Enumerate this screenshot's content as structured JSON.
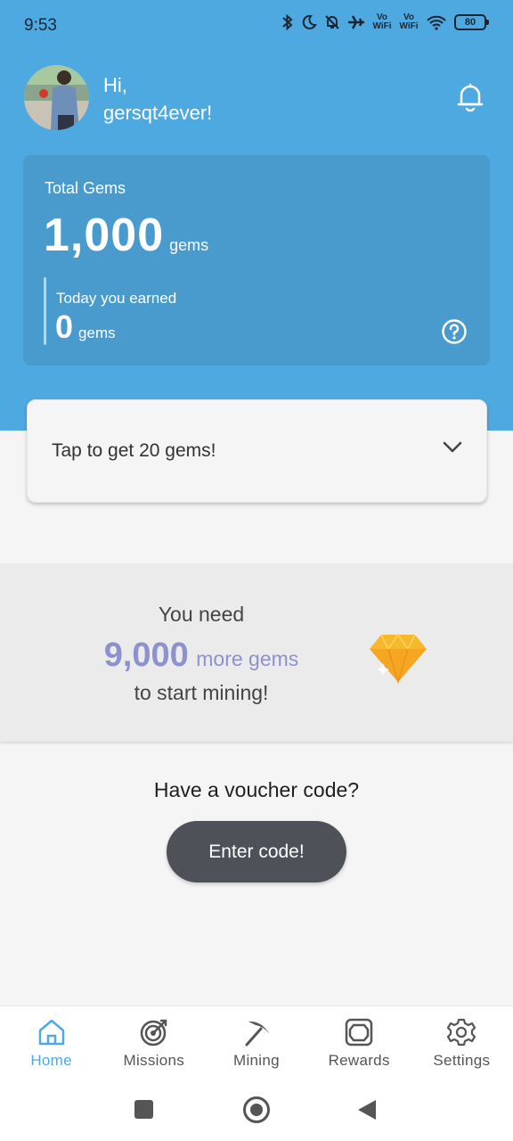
{
  "status_bar": {
    "time": "9:53",
    "vowifi_1": "Vo WiFi",
    "vowifi_2": "Vo WiFi",
    "battery": "80",
    "icons": [
      "bluetooth-icon",
      "moon-icon",
      "bell-muted-icon",
      "airplane-icon",
      "wifi-icon"
    ]
  },
  "header": {
    "greeting_line1": "Hi,",
    "greeting_line2": "gersqt4ever!"
  },
  "gems": {
    "label": "Total Gems",
    "total": "1,000",
    "unit": "gems",
    "today_label": "Today you earned",
    "today_value": "0",
    "today_unit": "gems"
  },
  "tap": {
    "label": "Tap to get 20 gems!"
  },
  "mining": {
    "line1": "You need",
    "amount": "9,000",
    "amount_suffix": "more gems",
    "line3": "to start mining!"
  },
  "voucher": {
    "title": "Have a voucher code?",
    "button": "Enter code!"
  },
  "nav": {
    "items": [
      {
        "label": "Home",
        "icon": "home-icon"
      },
      {
        "label": "Missions",
        "icon": "target-icon"
      },
      {
        "label": "Mining",
        "icon": "pickaxe-icon"
      },
      {
        "label": "Rewards",
        "icon": "gift-box-icon"
      },
      {
        "label": "Settings",
        "icon": "gear-icon"
      }
    ]
  },
  "colors": {
    "primary": "#4ea9e0",
    "card": "#4a9bcd",
    "accent_purple": "#8d92cf",
    "button_dark": "#4f5158",
    "diamond": "#f7b82c"
  }
}
